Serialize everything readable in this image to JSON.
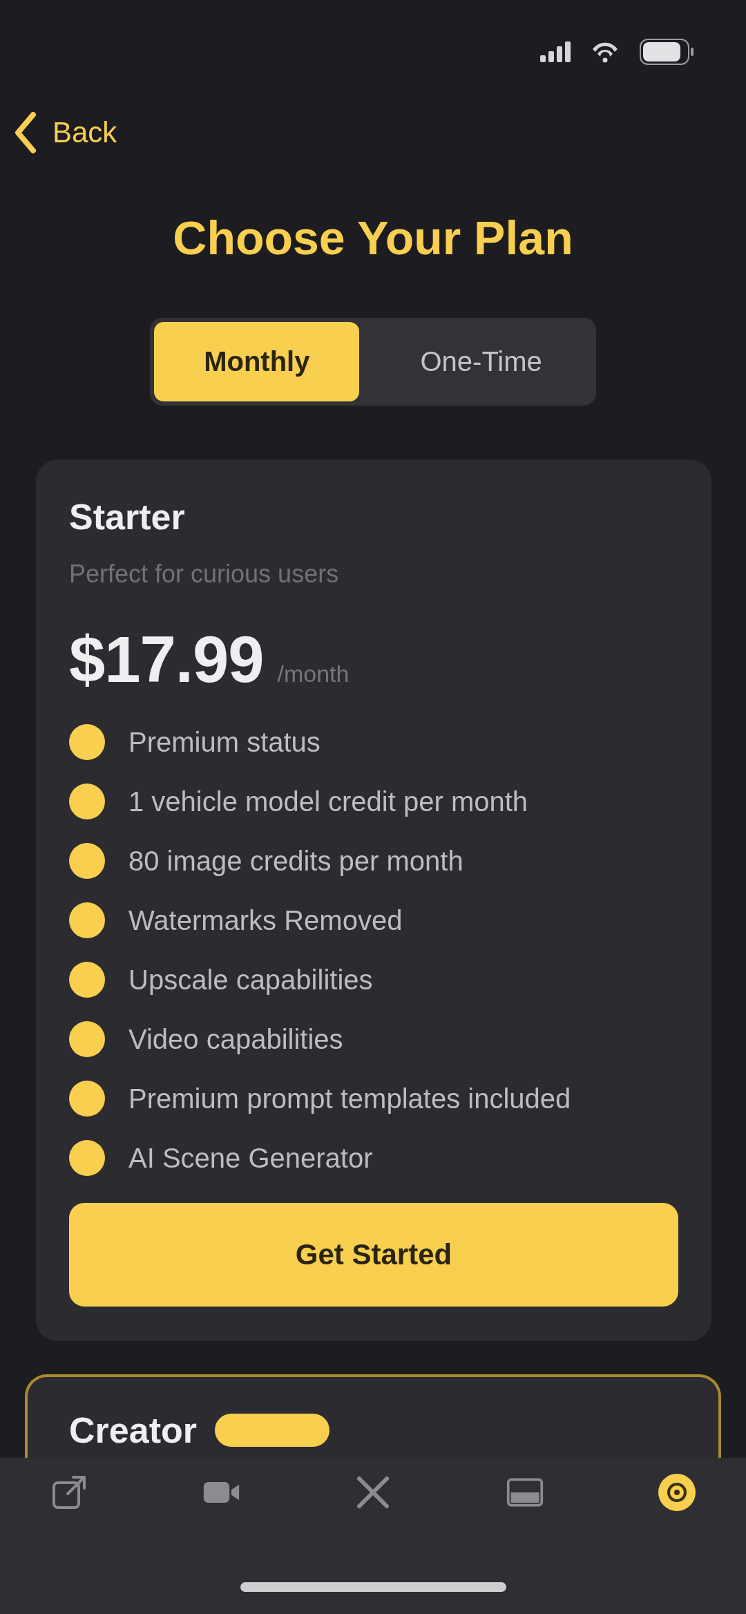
{
  "back": {
    "label": "Back"
  },
  "title": "Choose Your Plan",
  "billing_options": [
    {
      "label": "Monthly",
      "selected": true
    },
    {
      "label": "One-Time",
      "selected": false
    }
  ],
  "plans": [
    {
      "name": "Starter",
      "featured": false,
      "subtitle": "Perfect for curious users",
      "price": "$17.99",
      "period": "/month",
      "features": [
        "Premium status",
        "1 vehicle model credit per month",
        "80 image credits per month",
        "Watermarks Removed",
        "Upscale capabilities",
        "Video capabilities",
        "Premium prompt templates included",
        "AI Scene Generator"
      ],
      "button": "Get Started"
    },
    {
      "name": "Creator",
      "featured": true
    }
  ],
  "tab_bar": [
    {
      "kind": "share",
      "selected": false
    },
    {
      "kind": "video",
      "selected": false
    },
    {
      "kind": "tools",
      "selected": false
    },
    {
      "kind": "gallery",
      "selected": false
    },
    {
      "kind": "account",
      "selected": true
    }
  ]
}
